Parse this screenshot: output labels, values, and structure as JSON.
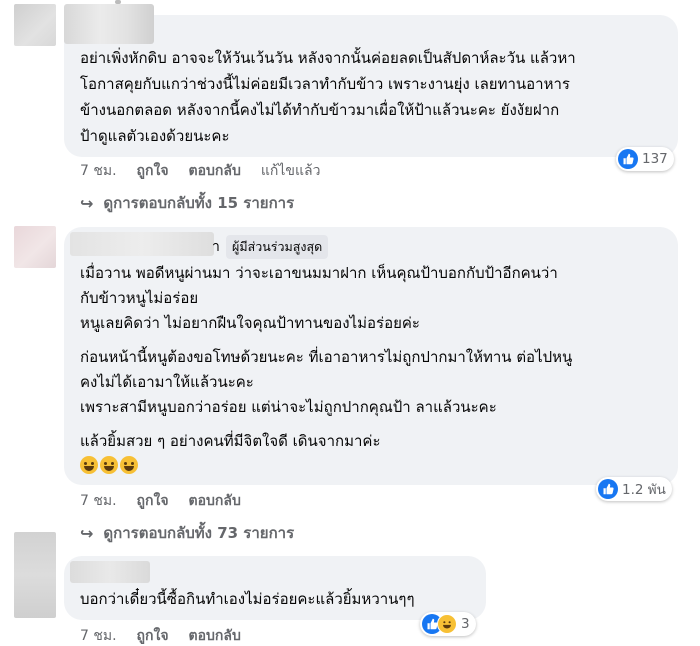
{
  "comments": [
    {
      "lines": [
        "อย่าเพิ่งหักดิบ อาจจะให้วันเว้นวัน หลังจากนั้นค่อยลดเป็นสัปดาห์ละวัน แล้วหา",
        "โอกาสคุยกับแกว่าช่วงนี้ไม่ค่อยมีเวลาทำกับข้าว เพราะงานยุ่ง เลยทานอาหาร",
        "ข้างนอกตลอด หลังจากนี้คงไม่ได้ทำกับข้าวมาเผื่อให้ป้าแล้วนะคะ ยังงัยฝาก",
        "ป้าดูแลตัวเองด้วยนะคะ"
      ],
      "time": "7 ชม.",
      "like_label": "ถูกใจ",
      "reply_label": "ตอบกลับ",
      "edited_label": "แก้ไขแล้ว",
      "reaction_count": "137",
      "view_replies": "ดูการตอบกลับทั้ง 15 รายการ"
    },
    {
      "name_tail": "า",
      "badge": "ผู้มีส่วนร่วมสูงสุด",
      "lines": [
        "เมื่อวาน พอดีหนูผ่านมา ว่าจะเอาขนมมาฝาก เห็นคุณป้าบอกกับป้าอีกคนว่า",
        "กับข้าวหนูไม่อร่อย",
        "หนูเลยคิดว่า ไม่อยากฝืนใจคุณป้าทานของไม่อร่อยค่ะ",
        "ก่อนหน้านี้หนูต้องขอโทษด้วยนะคะ ที่เอาอาหารไม่ถูกปากมาให้ทาน ต่อไปหนู",
        "คงไม่ได้เอามาให้แล้วนะคะ",
        "เพราะสามีหนูบอกว่าอร่อย แต่น่าจะไม่ถูกปากคุณป้า ลาแล้วนะคะ",
        "แล้วยิ้มสวย ๆ อย่างคนที่มีจิตใจดี เดินจากมาค่ะ"
      ],
      "emoji": "grinning-face ×3",
      "time": "7 ชม.",
      "like_label": "ถูกใจ",
      "reply_label": "ตอบกลับ",
      "reaction_count": "1.2 พัน",
      "view_replies": "ดูการตอบกลับทั้ง 73 รายการ"
    },
    {
      "lines": [
        "บอกว่าเดี๋ยวนี้ซื้อกินทำเองไม่อร่อยคะแล้วยิ้มหวานๆๆ"
      ],
      "time": "7 ชม.",
      "like_label": "ถูกใจ",
      "reply_label": "ตอบกลับ",
      "reaction_count": "3"
    }
  ],
  "colors": {
    "bubble": "#f0f2f5",
    "meta_text": "#65676b",
    "like_blue": "#1877f2",
    "haha_yellow": "#f7c035"
  },
  "icons": [
    "like-icon",
    "haha-icon",
    "reply-arrow-icon",
    "grinning-face-icon"
  ]
}
